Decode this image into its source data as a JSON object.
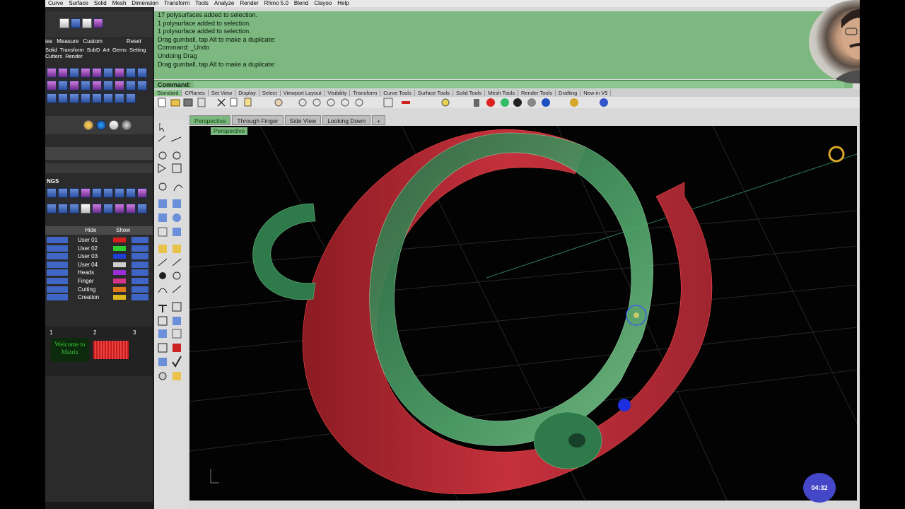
{
  "menu": [
    "Curve",
    "Surface",
    "Solid",
    "Mesh",
    "Dimension",
    "Transform",
    "Tools",
    "Analyze",
    "Render",
    "Rhino 5.0",
    "Blend",
    "Clayoo",
    "Help"
  ],
  "left_panel": {
    "tabs_row": [
      "ies",
      "Measure",
      "Custom",
      "Reset"
    ],
    "tool_row": [
      "Solid",
      "Transform",
      "SubD",
      "Art",
      "Gems",
      "Setting",
      "Cutters",
      "Render"
    ],
    "section_label": "NGS",
    "layer_header": {
      "hide": "Hide",
      "show": "Show"
    },
    "layers": [
      {
        "name": "User 01",
        "color": "#d62020"
      },
      {
        "name": "User 02",
        "color": "#2fcf2f"
      },
      {
        "name": "User 03",
        "color": "#1f3fd6"
      },
      {
        "name": "User 04",
        "color": "#cfcfcf"
      },
      {
        "name": "Heads",
        "color": "#9b2fd6"
      },
      {
        "name": "Finger",
        "color": "#d6348a"
      },
      {
        "name": "Cutting",
        "color": "#e07a1b"
      },
      {
        "name": "Creation",
        "color": "#e0b81b"
      }
    ],
    "preview_tabs": [
      "1",
      "2",
      "3"
    ],
    "preview_text": "Welcome to Matrix"
  },
  "command_history": [
    "17 polysurfaces added to selection.",
    "1 polysurface added to selection.",
    "1 polysurface added to selection.",
    "Drag gumball, tap Alt to make a duplicate:",
    "Command: _Undo",
    "Undoing Drag",
    "Drag gumball, tap Alt to make a duplicate:"
  ],
  "command_prompt": "Command:",
  "toolbar_tabs": [
    "Standard",
    "CPlanes",
    "Set View",
    "Display",
    "Select",
    "Viewport Layout",
    "Visibility",
    "Transform",
    "Curve Tools",
    "Surface Tools",
    "Solid Tools",
    "Mesh Tools",
    "Render Tools",
    "Drafting",
    "New in V5"
  ],
  "view_tabs": [
    "Perspective",
    "Through Finger",
    "Side View",
    "Looking Down",
    "+"
  ],
  "viewport_label": "Perspective",
  "timer": "04:32",
  "colors": {
    "command_bg": "#7cb87f",
    "red_part": "#c4313c",
    "green_part": "#4fa36a"
  }
}
